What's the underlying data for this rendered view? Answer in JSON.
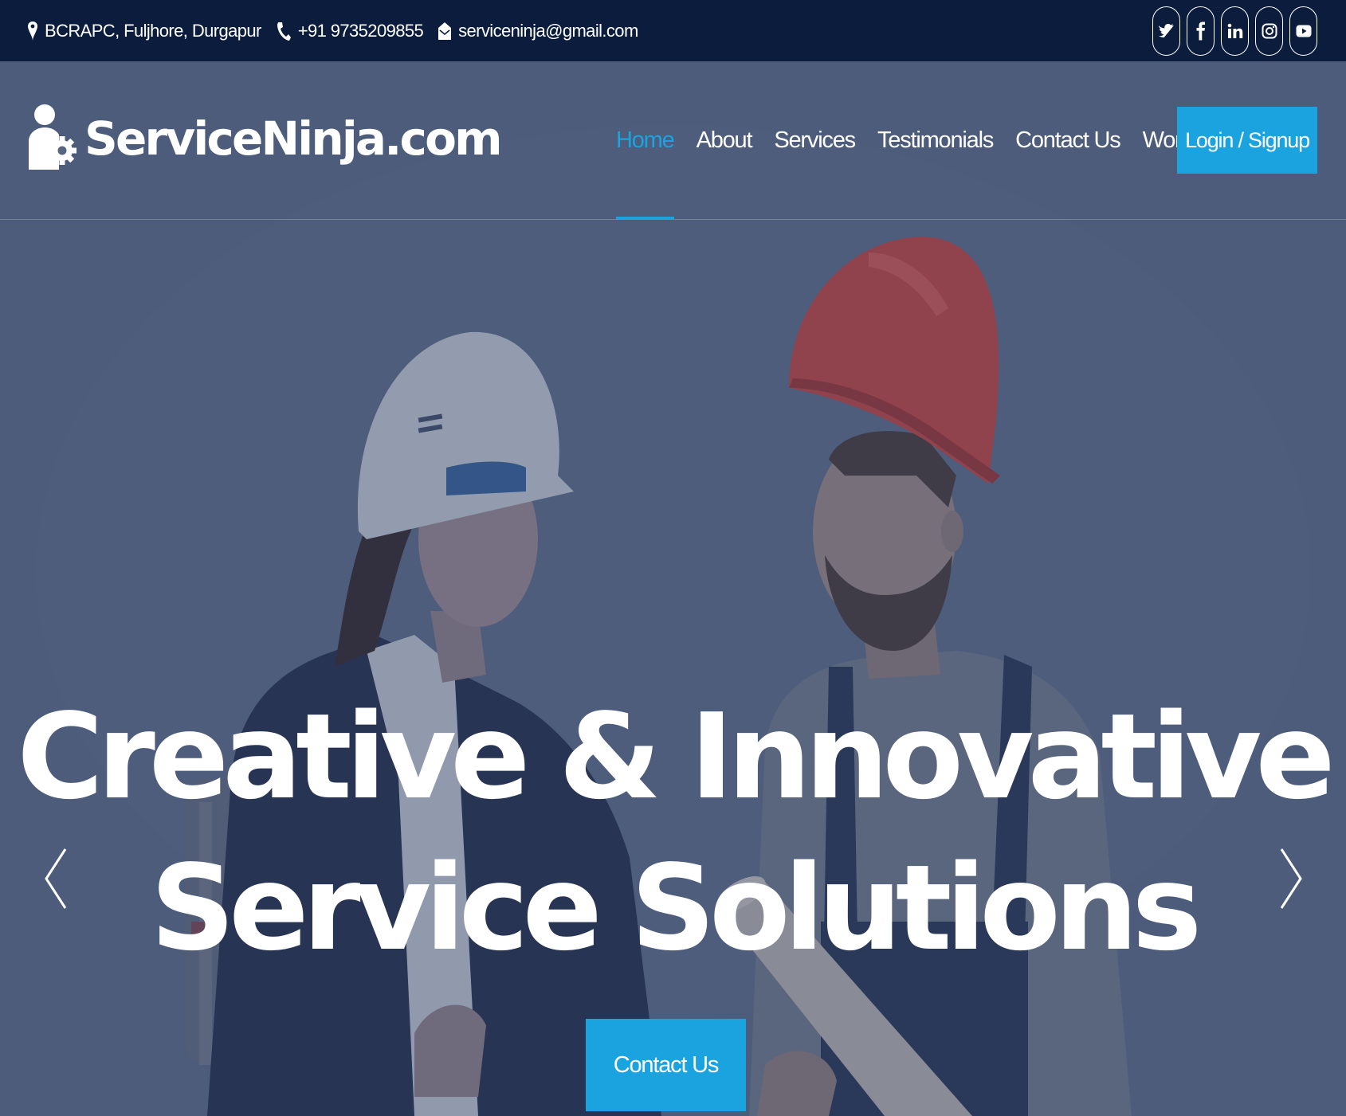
{
  "topbar": {
    "address": "BCRAPC, Fuljhore, Durgapur",
    "phone": "+91 9735209855",
    "email": "serviceninja@gmail.com",
    "socials": [
      "twitter-icon",
      "facebook-icon",
      "linkedin-icon",
      "instagram-icon",
      "youtube-icon"
    ]
  },
  "navbar": {
    "logo_text": "ServiceNinja.com",
    "items": [
      {
        "label": "Home",
        "active": true
      },
      {
        "label": "About"
      },
      {
        "label": "Services"
      },
      {
        "label": "Testimonials"
      },
      {
        "label": "Contact Us"
      },
      {
        "label": "Work with Us"
      }
    ],
    "login_label": "Login / Signup"
  },
  "hero": {
    "headline_line1": "Creative & Innovative",
    "headline_line2": "Service Solutions",
    "cta_label": "Contact Us",
    "prev_icon": "chevron-left-icon",
    "next_icon": "chevron-right-icon"
  },
  "colors": {
    "topbar_bg": "#0b1c3d",
    "accent": "#1aa3df",
    "overlay": "#4a5b78"
  }
}
